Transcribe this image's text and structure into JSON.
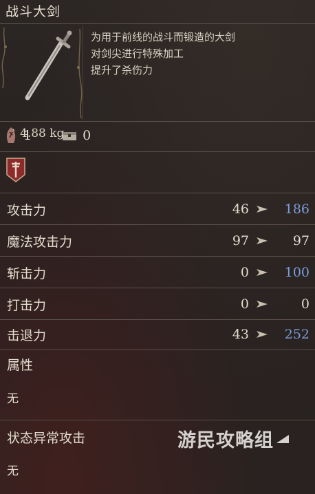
{
  "item": {
    "name": "战斗大剑",
    "weight": "4.88 kg",
    "description": [
      "为用于前线的战斗而锻造的大剑",
      "对剑尖进行特殊加工",
      "提升了杀伤力"
    ]
  },
  "requirements": [
    {
      "icon": "rune-icon",
      "value": "1"
    },
    {
      "icon": "chest-icon",
      "value": "0"
    }
  ],
  "stats": [
    {
      "label": "攻击力",
      "current": "46",
      "new": "186",
      "new_color": "#7d9dd9"
    },
    {
      "label": "魔法攻击力",
      "current": "97",
      "new": "97",
      "new_color": "#e4ddcf"
    },
    {
      "label": "斩击力",
      "current": "0",
      "new": "100",
      "new_color": "#7d9dd9"
    },
    {
      "label": "打击力",
      "current": "0",
      "new": "0",
      "new_color": "#e4ddcf"
    },
    {
      "label": "击退力",
      "current": "43",
      "new": "252",
      "new_color": "#7d9dd9"
    }
  ],
  "attributes": {
    "label": "属性",
    "value": "无"
  },
  "status_ailment": {
    "label": "状态异常攻击",
    "value": "无"
  },
  "watermark": "游民攻略组"
}
